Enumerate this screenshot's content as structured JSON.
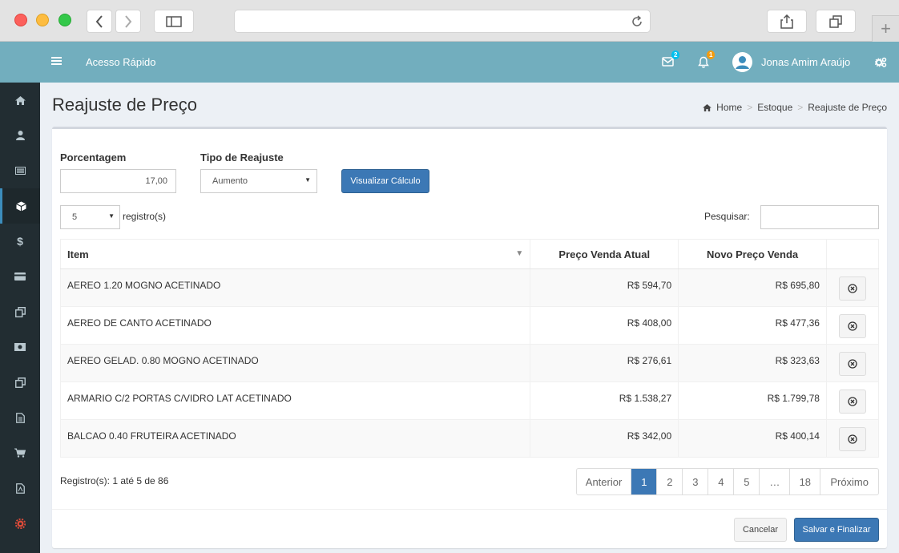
{
  "app": {
    "quick_access": "Acesso Rápido",
    "user_name": "Jonas Amim Araújo",
    "mail_count": "2",
    "notif_count": "1"
  },
  "page": {
    "title": "Reajuste de Preço",
    "breadcrumb": [
      "Home",
      "Estoque",
      "Reajuste de Preço"
    ]
  },
  "form": {
    "percent_label": "Porcentagem",
    "percent_value": "17,00",
    "type_label": "Tipo de Reajuste",
    "type_value": "Aumento",
    "calc_button": "Visualizar Cálculo"
  },
  "table_controls": {
    "page_size": "5",
    "records_label": "registro(s)",
    "search_label": "Pesquisar:"
  },
  "table": {
    "headers": [
      "Item",
      "Preço Venda Atual",
      "Novo Preço Venda"
    ],
    "rows": [
      {
        "item": "AEREO 1.20 MOGNO ACETINADO",
        "current": "R$ 594,70",
        "new": "R$ 695,80"
      },
      {
        "item": "AEREO DE CANTO ACETINADO",
        "current": "R$ 408,00",
        "new": "R$ 477,36"
      },
      {
        "item": "AEREO GELAD. 0.80 MOGNO ACETINADO",
        "current": "R$ 276,61",
        "new": "R$ 323,63"
      },
      {
        "item": "ARMARIO C/2 PORTAS C/VIDRO LAT ACETINADO",
        "current": "R$ 1.538,27",
        "new": "R$ 1.799,78"
      },
      {
        "item": "BALCAO 0.40 FRUTEIRA ACETINADO",
        "current": "R$ 342,00",
        "new": "R$ 400,14"
      }
    ]
  },
  "pagination": {
    "info": "Registro(s): 1 até 5 de 86",
    "prev": "Anterior",
    "pages": [
      "1",
      "2",
      "3",
      "4",
      "5",
      "…",
      "18"
    ],
    "next": "Próximo",
    "current": "1"
  },
  "actions": {
    "cancel": "Cancelar",
    "save": "Salvar e Finalizar"
  },
  "colors": {
    "navbar": "#72aebe",
    "sidebar": "#222d32",
    "primary": "#3c78b5"
  }
}
